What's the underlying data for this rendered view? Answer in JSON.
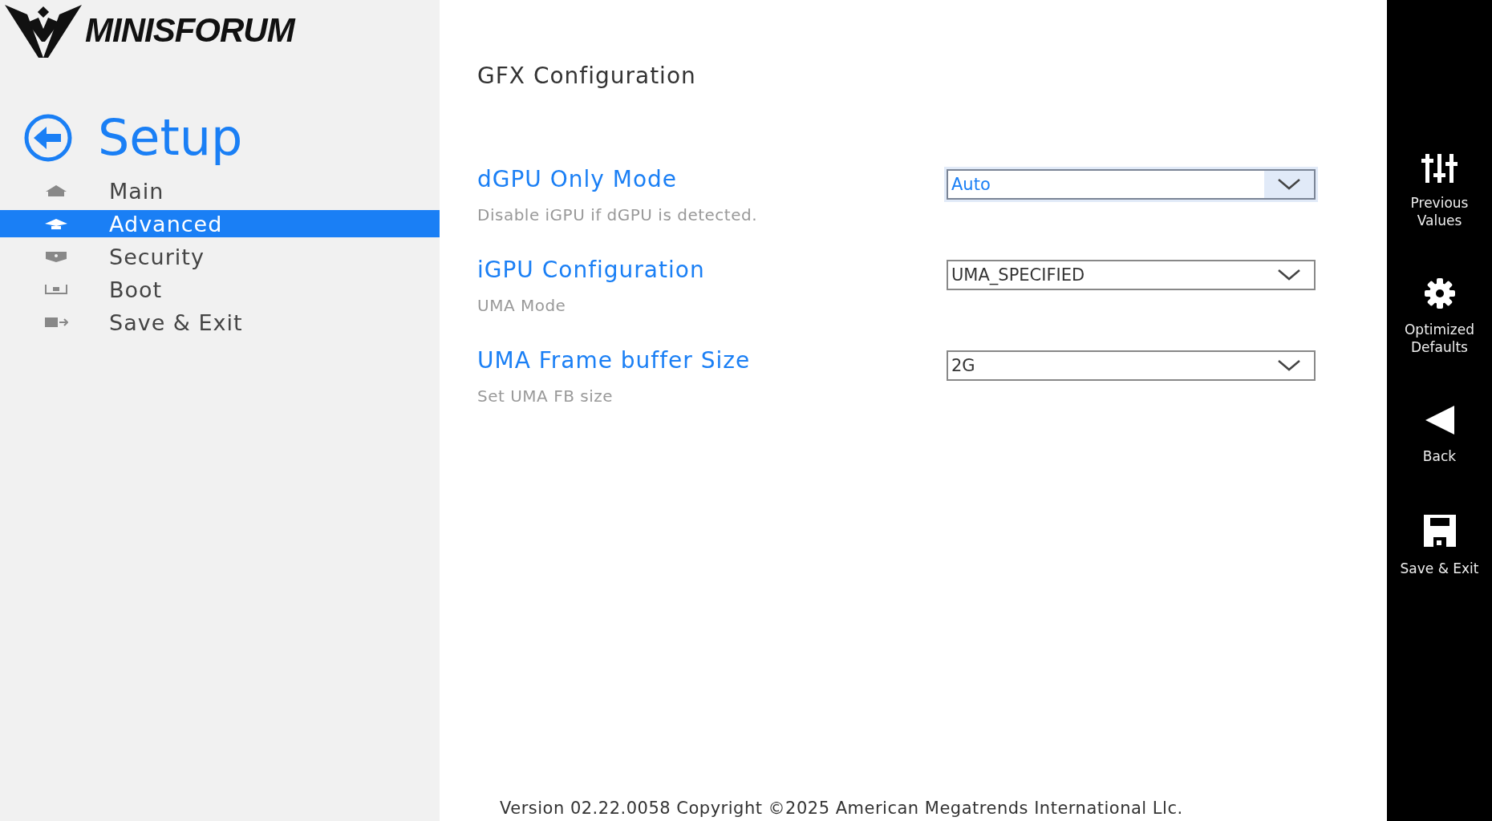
{
  "logo": {
    "text": "MINISFORUM"
  },
  "sidebar": {
    "title": "Setup",
    "items": [
      {
        "label": "Main",
        "kind": "home",
        "selected": false
      },
      {
        "label": "Advanced",
        "kind": "advanced",
        "selected": true
      },
      {
        "label": "Security",
        "kind": "security",
        "selected": false
      },
      {
        "label": "Boot",
        "kind": "boot",
        "selected": false
      },
      {
        "label": "Save & Exit",
        "kind": "exit",
        "selected": false
      }
    ]
  },
  "page": {
    "title": "GFX Configuration",
    "settings": [
      {
        "label": "dGPU Only Mode",
        "description": "Disable iGPU if dGPU is detected.",
        "value": "Auto",
        "selected": true
      },
      {
        "label": "iGPU Configuration",
        "description": "UMA Mode",
        "value": "UMA_SPECIFIED",
        "selected": false
      },
      {
        "label": "UMA Frame buffer Size",
        "description": "Set UMA FB size",
        "value": "2G",
        "selected": false
      }
    ]
  },
  "actions": [
    {
      "label": "Previous Values",
      "kind": "sliders"
    },
    {
      "label": "Optimized Defaults",
      "kind": "gear"
    },
    {
      "label": "Back",
      "kind": "back"
    },
    {
      "label": "Save & Exit",
      "kind": "save"
    }
  ],
  "footer": {
    "text": "Version 02.22.0058 Copyright ©2025 American Megatrends International Llc."
  }
}
